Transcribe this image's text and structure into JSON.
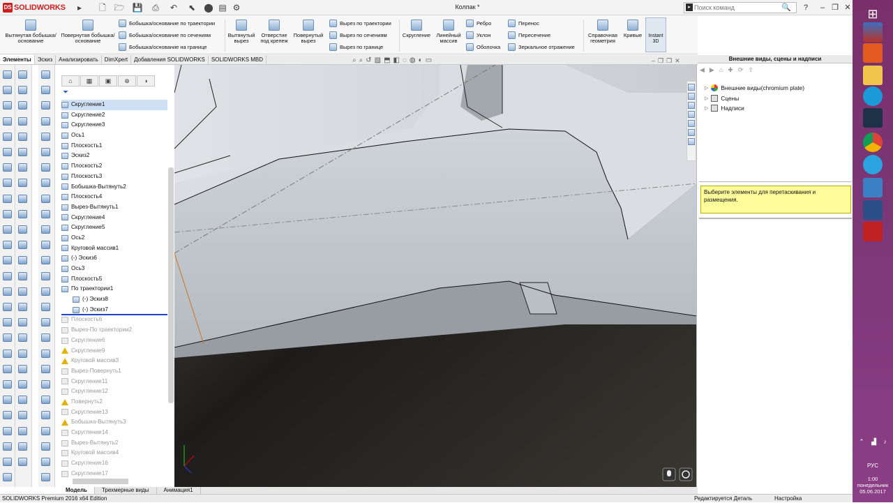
{
  "app": {
    "brand": "SOLIDWORKS",
    "document_title": "Колпак *"
  },
  "search": {
    "placeholder": "Поиск команд"
  },
  "ribbon": {
    "big": [
      {
        "label": "Вытянутая бобышка/основание"
      },
      {
        "label": "Повернутая бобышка/основание"
      },
      {
        "label": "Вытянутый вырез"
      },
      {
        "label": "Отверстие под крепеж"
      },
      {
        "label": "Повернутый вырез"
      },
      {
        "label": "Скругление"
      },
      {
        "label": "Линейный массив"
      },
      {
        "label": "Справочная геометрия"
      },
      {
        "label": "Кривые"
      },
      {
        "label": "Instant 3D"
      }
    ],
    "small": [
      {
        "label": "Бобышка/основание по траектории"
      },
      {
        "label": "Бобышка/основание по сечениям"
      },
      {
        "label": "Бобышка/основание на границе"
      },
      {
        "label": "Вырез по траектории"
      },
      {
        "label": "Вырез по сечениям"
      },
      {
        "label": "Вырез по границе"
      },
      {
        "label": "Ребро"
      },
      {
        "label": "Уклон"
      },
      {
        "label": "Оболочка"
      },
      {
        "label": "Перенос"
      },
      {
        "label": "Пересечение"
      },
      {
        "label": "Зеркальное отражение"
      }
    ]
  },
  "tabs": [
    {
      "label": "Элементы"
    },
    {
      "label": "Эскиз"
    },
    {
      "label": "Анализировать"
    },
    {
      "label": "DimXpert"
    },
    {
      "label": "Добавления SOLIDWORKS"
    },
    {
      "label": "SOLIDWORKS MBD"
    }
  ],
  "tree": [
    {
      "label": "Скругление1",
      "state": "selected"
    },
    {
      "label": "Скругление2"
    },
    {
      "label": "Скругление3"
    },
    {
      "label": "Ось1"
    },
    {
      "label": "Плоскость1"
    },
    {
      "label": "Эскиз2"
    },
    {
      "label": "Плоскость2"
    },
    {
      "label": "Плоскость3"
    },
    {
      "label": "Бобышка-Вытянуть2"
    },
    {
      "label": "Плоскость4"
    },
    {
      "label": "Вырез-Вытянуть1"
    },
    {
      "label": "Скругление4"
    },
    {
      "label": "Скругление5"
    },
    {
      "label": "Ось2"
    },
    {
      "label": "Круговой массив1"
    },
    {
      "label": "(-) Эскиз6"
    },
    {
      "label": "Ось3"
    },
    {
      "label": "Плоскость5"
    },
    {
      "label": "По траектории1"
    },
    {
      "label": "(-) Эскиз8",
      "indent": 1
    },
    {
      "label": "(-) Эскиз7",
      "indent": 1
    },
    {
      "label": "Плоскость6",
      "state": "suppressed"
    },
    {
      "label": "Вырез-По траектории2",
      "state": "suppressed"
    },
    {
      "label": "Скругление6",
      "state": "suppressed"
    },
    {
      "label": "Скругление9",
      "state": "suppressed",
      "warning": true
    },
    {
      "label": "Круговой массив3",
      "state": "suppressed",
      "warning": true
    },
    {
      "label": "Вырез-Повернуть1",
      "state": "suppressed"
    },
    {
      "label": "Скругление11",
      "state": "suppressed"
    },
    {
      "label": "Скругление12",
      "state": "suppressed"
    },
    {
      "label": "Повернуть2",
      "state": "suppressed",
      "warning": true
    },
    {
      "label": "Скругление13",
      "state": "suppressed"
    },
    {
      "label": "Бобышка-Вытянуть3",
      "state": "suppressed",
      "warning": true
    },
    {
      "label": "Скругление14",
      "state": "suppressed"
    },
    {
      "label": "Вырез-Вытянуть2",
      "state": "suppressed"
    },
    {
      "label": "Круговой массив4",
      "state": "suppressed"
    },
    {
      "label": "Скругление16",
      "state": "suppressed"
    },
    {
      "label": "Скругление17",
      "state": "suppressed"
    }
  ],
  "taskpane": {
    "title": "Внешние виды, сцены и надписи",
    "items": [
      {
        "label": "Внешние виды(chromium plate)"
      },
      {
        "label": "Сцены"
      },
      {
        "label": "Надписи"
      }
    ],
    "hint": "Выберите элементы для перетаскивания и размещения."
  },
  "bottom_tabs": [
    {
      "label": "Модель"
    },
    {
      "label": "Трехмерные виды"
    },
    {
      "label": "Анимация1"
    }
  ],
  "status": {
    "edition": "SOLIDWORKS Premium 2016 x64 Edition",
    "mode": "Редактируется Деталь",
    "settings": "Настройка"
  },
  "taskbar": {
    "lang": "РУС",
    "time": "1:00",
    "day": "понедельник",
    "date": "05.06.2017"
  },
  "colors": {
    "accent": "#cc1f1f",
    "selection": "#cfe0f5",
    "hint_bg": "#fefb9b",
    "taskbar": "#7a3776"
  }
}
